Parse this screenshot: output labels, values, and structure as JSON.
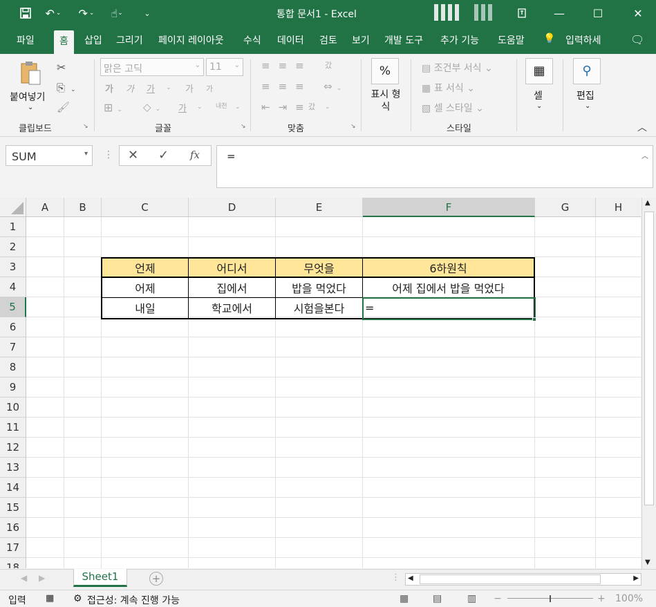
{
  "window": {
    "title": "통합 문서1  -  Excel",
    "minimize_glyph": "—",
    "maximize_glyph": "☐",
    "close_glyph": "✕"
  },
  "tabs": [
    "파일",
    "홈",
    "삽입",
    "그리기",
    "페이지 레이아웃",
    "수식",
    "데이터",
    "검토",
    "보기",
    "개발 도구",
    "추가 기능",
    "도움말",
    "입력하세"
  ],
  "ribbon": {
    "clipboard": {
      "paste_label": "붙여넣기",
      "group": "클립보드"
    },
    "font": {
      "font_name": "맑은 고딕",
      "font_size": "11",
      "group": "글꼴",
      "bold": "가",
      "italic": "가",
      "underline": "가",
      "grow": "가",
      "shrink": "가",
      "fontcolor": "가",
      "phonetic": "내천"
    },
    "alignment": {
      "group": "맞춤",
      "wrap": "갔",
      "orient": "갔"
    },
    "number": {
      "format_symbol": "%",
      "format_label": "표시 형식"
    },
    "styles": {
      "group": "스타일",
      "conditional": "조건부 서식",
      "as_table": "표 서식",
      "cell_styles": "셀 스타일"
    },
    "cells": {
      "label": "셀"
    },
    "editing": {
      "label": "편집"
    }
  },
  "formula_bar": {
    "name_box": "SUM",
    "fx": "fx",
    "formula": "="
  },
  "columns": [
    "A",
    "B",
    "C",
    "D",
    "E",
    "F",
    "G",
    "H"
  ],
  "rows": [
    "1",
    "2",
    "3",
    "4",
    "5",
    "6",
    "7",
    "8",
    "9",
    "10",
    "11",
    "12",
    "13",
    "14",
    "15",
    "16",
    "17",
    "18"
  ],
  "table": {
    "headers": [
      "언제",
      "어디서",
      "무엇을",
      "6하원칙"
    ],
    "rows": [
      [
        "어제",
        "집에서",
        "밥을 먹었다",
        "어제 집에서 밥을 먹었다"
      ],
      [
        "내일",
        "학교에서",
        "시험을본다",
        "="
      ]
    ]
  },
  "colors": {
    "accent": "#217346",
    "header_fill": "#ffe699"
  },
  "sheets": {
    "active": "Sheet1",
    "add": "+"
  },
  "status": {
    "mode": "입력",
    "accessibility": "접근성: 계속 진행 가능",
    "zoom": "100%"
  }
}
